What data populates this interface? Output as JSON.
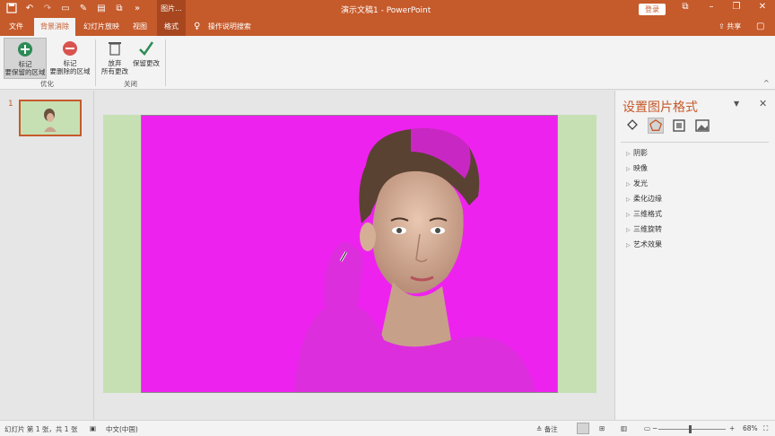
{
  "titlebar": {
    "context_tab": "图片...",
    "doc_title": "演示文稿1  -  PowerPoint",
    "login": "登录",
    "min": "–",
    "restore": "❐",
    "close": "✕",
    "opts": "⧉"
  },
  "tabs": [
    {
      "label": "文件"
    },
    {
      "label": "背景消除"
    },
    {
      "label": "幻灯片放映"
    },
    {
      "label": "视图"
    },
    {
      "label": "格式"
    }
  ],
  "search_label": "操作说明搜索",
  "share_label": "共享",
  "ribbon": {
    "mark_keep_1": "标记",
    "mark_keep_2": "要保留的区域",
    "mark_remove_1": "标记",
    "mark_remove_2": "要删除的区域",
    "discard_1": "放弃",
    "discard_2": "所有更改",
    "keep_changes": "保留更改",
    "group_optimize": "优化",
    "group_close": "关闭"
  },
  "thumbnails": {
    "slide_number": "1"
  },
  "format_pane": {
    "title": "设置图片格式",
    "items": [
      {
        "label": "阴影"
      },
      {
        "label": "映像"
      },
      {
        "label": "发光"
      },
      {
        "label": "柔化边缘"
      },
      {
        "label": "三维格式"
      },
      {
        "label": "三维旋转"
      },
      {
        "label": "艺术效果"
      }
    ]
  },
  "statusbar": {
    "slide_info": "幻灯片 第 1 张，共 1 张",
    "language": "中文(中国)",
    "notes": "备注",
    "zoom": "68%",
    "minus": "−",
    "plus": "+"
  },
  "colors": {
    "accent": "#c55a2b",
    "slide_bg": "#c6e0b4",
    "removal_magenta": "#ee22ee"
  }
}
